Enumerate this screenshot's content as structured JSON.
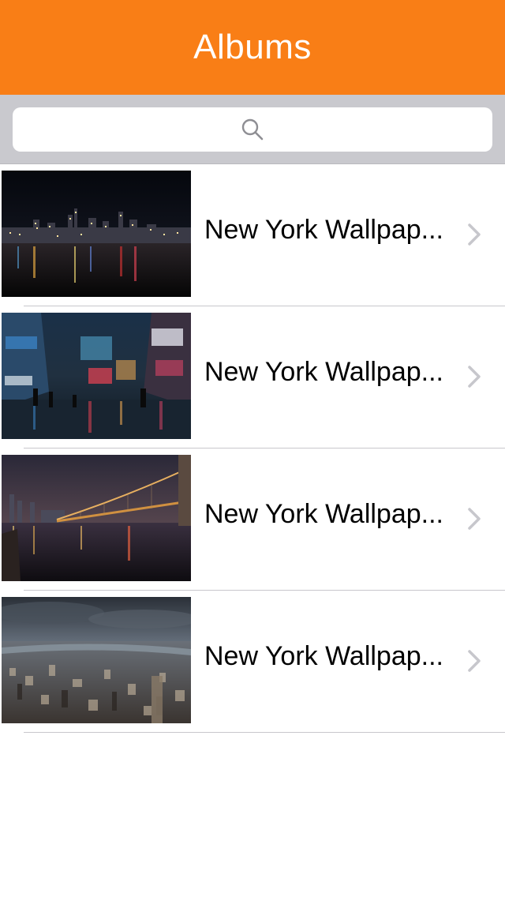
{
  "navbar": {
    "title": "Albums",
    "background": "#f97e16"
  },
  "search": {
    "placeholder": "",
    "icon": "search-icon"
  },
  "albums": [
    {
      "title": "New York Wallpap...",
      "thumbnail": "night skyline over water"
    },
    {
      "title": "New York Wallpap...",
      "thumbnail": "times square rainy night"
    },
    {
      "title": "New York Wallpap...",
      "thumbnail": "brooklyn bridge at night"
    },
    {
      "title": "New York Wallpap...",
      "thumbnail": "aerial city under cloudy sky"
    }
  ]
}
